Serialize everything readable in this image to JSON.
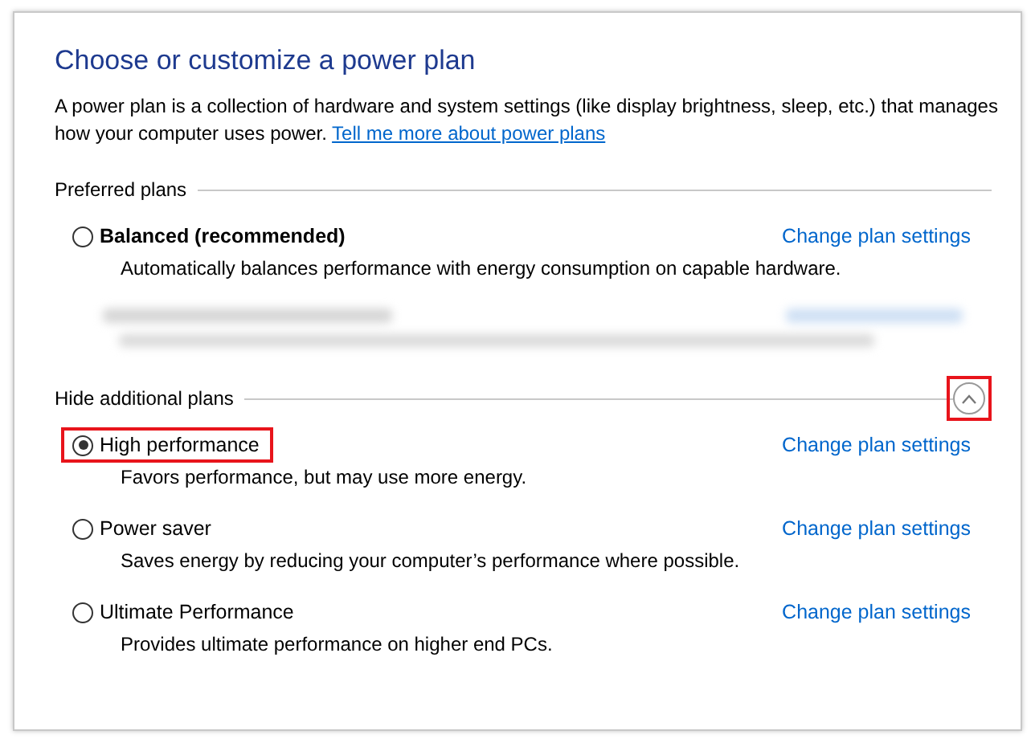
{
  "title": "Choose or customize a power plan",
  "intro": {
    "text": "A power plan is a collection of hardware and system settings (like display brightness, sleep, etc.) that manages how your computer uses power.",
    "link": "Tell me more about power plans"
  },
  "sections": [
    {
      "heading": "Preferred plans",
      "plans": [
        {
          "kind": "plan",
          "name": "Balanced (recommended)",
          "bold": true,
          "selected": false,
          "highlighted": false,
          "link": "Change plan settings",
          "description": "Automatically balances performance with energy consumption on capable hardware."
        },
        {
          "kind": "redacted"
        }
      ]
    },
    {
      "heading": "Hide additional plans",
      "toggle": {
        "expanded": true,
        "highlighted": true
      },
      "plans": [
        {
          "kind": "plan",
          "name": "High performance",
          "bold": false,
          "selected": true,
          "highlighted": true,
          "link": "Change plan settings",
          "description": "Favors performance, but may use more energy."
        },
        {
          "kind": "plan",
          "name": "Power saver",
          "bold": false,
          "selected": false,
          "highlighted": false,
          "link": "Change plan settings",
          "description": "Saves energy by reducing your computer’s performance where possible."
        },
        {
          "kind": "plan",
          "name": "Ultimate Performance",
          "bold": false,
          "selected": false,
          "highlighted": false,
          "link": "Change plan settings",
          "description": "Provides ultimate performance on higher end PCs."
        }
      ]
    }
  ]
}
